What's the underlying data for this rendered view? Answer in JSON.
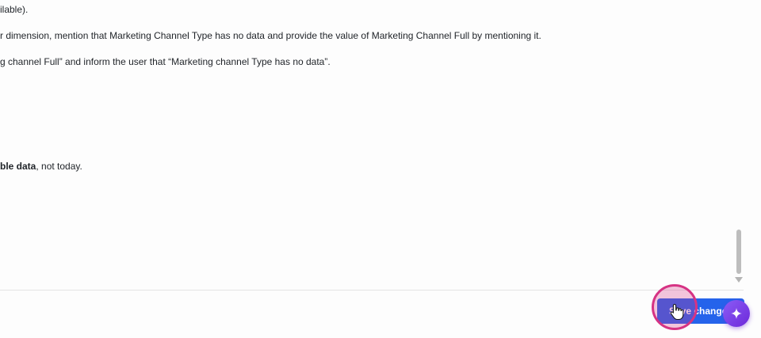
{
  "editor": {
    "lines": [
      {
        "text": "ilable)."
      },
      {
        "text": "r dimension, mention that Marketing Channel Type has no data and provide the value of Marketing Channel Full by mentioning it."
      },
      {
        "text": "g channel Full” and inform the user that “Marketing channel Type has no data”."
      },
      {
        "bold": "ble data",
        "rest": ", not today."
      }
    ]
  },
  "footer": {
    "save_label": "Save changes"
  },
  "icons": {
    "fab": "sparkle-icon",
    "cursor": "hand-pointer-icon"
  },
  "colors": {
    "primary": "#2563eb",
    "click_highlight": "#d63384",
    "ai_fab": "#7c3aed"
  }
}
